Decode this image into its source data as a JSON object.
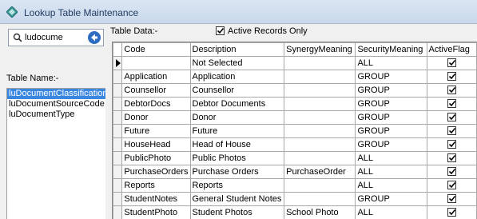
{
  "window": {
    "title": "Lookup Table Maintenance"
  },
  "search": {
    "value": "ludocume"
  },
  "left": {
    "table_name_label": "Table Name:-",
    "tables": [
      {
        "name": "luDocumentClassification",
        "selected": true
      },
      {
        "name": "luDocumentSourceCode",
        "selected": false
      },
      {
        "name": "luDocumentType",
        "selected": false
      }
    ]
  },
  "main": {
    "table_data_label": "Table Data:-",
    "active_only_label": "Active Records Only",
    "active_only_checked": true
  },
  "grid": {
    "columns": [
      "Code",
      "Description",
      "SynergyMeaning",
      "SecurityMeaning",
      "ActiveFlag"
    ],
    "rows": [
      {
        "code": "",
        "description": "Not Selected",
        "synergy": "",
        "security": "ALL",
        "active": true,
        "current": true
      },
      {
        "code": "Application",
        "description": "Application",
        "synergy": "",
        "security": "GROUP",
        "active": true
      },
      {
        "code": "Counsellor",
        "description": "Counsellor",
        "synergy": "",
        "security": "GROUP",
        "active": true
      },
      {
        "code": "DebtorDocs",
        "description": "Debtor Documents",
        "synergy": "",
        "security": "GROUP",
        "active": true
      },
      {
        "code": "Donor",
        "description": "Donor",
        "synergy": "",
        "security": "GROUP",
        "active": true
      },
      {
        "code": "Future",
        "description": "Future",
        "synergy": "",
        "security": "GROUP",
        "active": true
      },
      {
        "code": "HouseHead",
        "description": "Head of House",
        "synergy": "",
        "security": "GROUP",
        "active": true
      },
      {
        "code": "PublicPhoto",
        "description": "Public Photos",
        "synergy": "",
        "security": "ALL",
        "active": true
      },
      {
        "code": "PurchaseOrders",
        "description": "Purchase Orders",
        "synergy": "PurchaseOrder",
        "security": "ALL",
        "active": true
      },
      {
        "code": "Reports",
        "description": "Reports",
        "synergy": "",
        "security": "ALL",
        "active": true
      },
      {
        "code": "StudentNotes",
        "description": "General Student Notes",
        "synergy": "",
        "security": "GROUP",
        "active": true
      },
      {
        "code": "StudentPhoto",
        "description": "Student Photos",
        "synergy": "School Photo",
        "security": "ALL",
        "active": true
      }
    ]
  },
  "colors": {
    "titlebar": "#c9d8ec",
    "selection": "#3b87e0",
    "go_button": "#2d6cc0"
  }
}
